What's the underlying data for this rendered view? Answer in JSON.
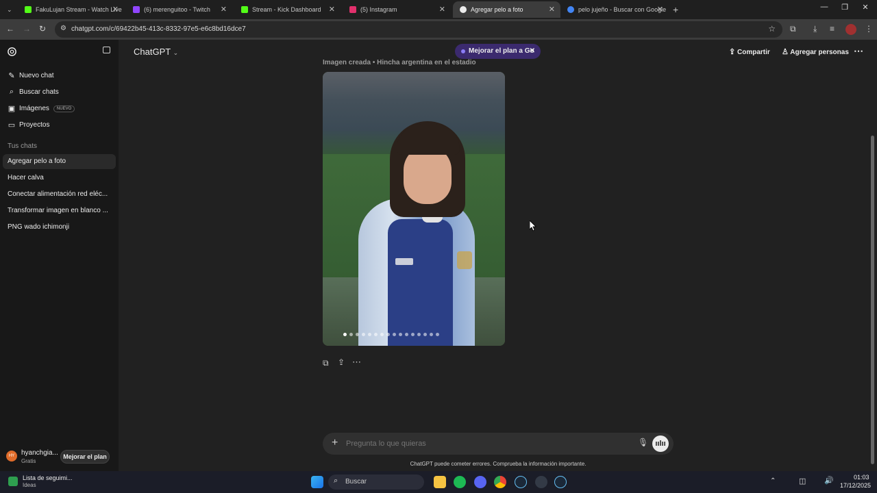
{
  "browser": {
    "tabs": [
      {
        "label": "FakuLujan Stream - Watch Live",
        "color": "#53fc18"
      },
      {
        "label": "(6) merenguitoo - Twitch",
        "color": "#9146ff"
      },
      {
        "label": "Stream - Kick Dashboard",
        "color": "#53fc18"
      },
      {
        "label": "(5) Instagram",
        "color": "#e1306c"
      },
      {
        "label": "Agregar pelo a foto",
        "color": "#ececec"
      },
      {
        "label": "pelo jujeño - Buscar con Google",
        "color": "#4285f4"
      }
    ],
    "active_tab": 4,
    "url": "chatgpt.com/c/69422b45-413c-8332-97e5-e6c8bd16dce7"
  },
  "sidebar": {
    "new_chat": "Nuevo chat",
    "search_chats": "Buscar chats",
    "images": "Imágenes",
    "images_badge": "NUEVO",
    "projects": "Proyectos",
    "section_title": "Tus chats",
    "chats": [
      "Agregar pelo a foto",
      "Hacer calva",
      "Conectar alimentación red eléc...",
      "Transformar imagen en blanco ...",
      "PNG wado ichimonji"
    ],
    "user": {
      "initials": "HY",
      "name": "hyanchgia...",
      "plan": "Gratis",
      "upgrade": "Mejorar el plan"
    }
  },
  "header": {
    "model": "ChatGPT",
    "promo": "Mejorar el plan a Go",
    "share": "Compartir",
    "add_people": "Agregar personas"
  },
  "conversation": {
    "image_caption": "Imagen creada • Hincha argentina en el estadio",
    "carousel_dots": 16
  },
  "composer": {
    "placeholder": "Pregunta lo que quieras",
    "disclaimer": "ChatGPT puede cometer errores. Comprueba la información importante."
  },
  "taskbar": {
    "widget_title": "Lista de seguimi...",
    "widget_sub": "Ideas",
    "search": "Buscar",
    "time": "01:03",
    "date": "17/12/2025"
  }
}
